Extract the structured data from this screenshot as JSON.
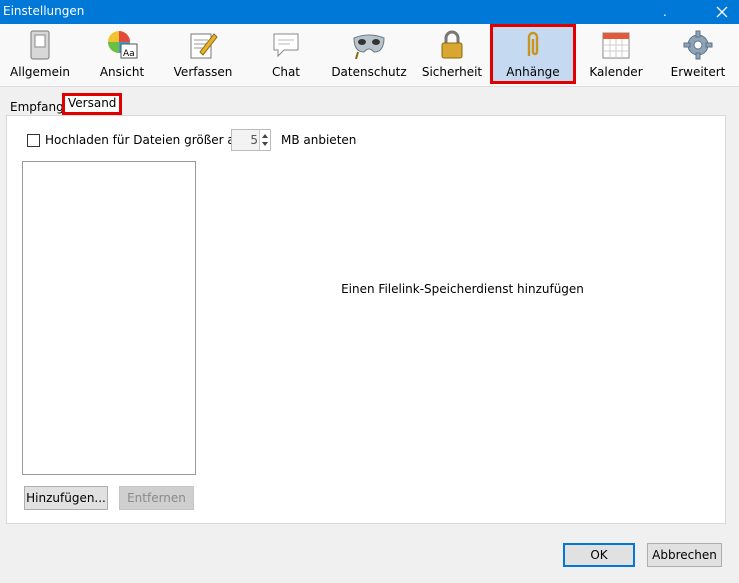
{
  "window": {
    "title": "Einstellungen",
    "dot": "."
  },
  "toolbar": [
    {
      "label": "Allgemein",
      "icon": "switch-icon"
    },
    {
      "label": "Ansicht",
      "icon": "palette-icon"
    },
    {
      "label": "Verfassen",
      "icon": "compose-icon"
    },
    {
      "label": "Chat",
      "icon": "chat-bubble-icon"
    },
    {
      "label": "Datenschutz",
      "icon": "mask-icon"
    },
    {
      "label": "Sicherheit",
      "icon": "padlock-icon"
    },
    {
      "label": "Anhänge",
      "icon": "paperclip-icon",
      "selected": true
    },
    {
      "label": "Kalender",
      "icon": "calendar-icon"
    },
    {
      "label": "Erweitert",
      "icon": "gear-icon"
    }
  ],
  "subtabs": [
    {
      "label": "Empfang"
    },
    {
      "label": "Versand",
      "active": true
    }
  ],
  "upload": {
    "checkbox_label": "Hochladen für Dateien größer als",
    "checked": false,
    "size_value": "5",
    "unit_label": "MB anbieten"
  },
  "providers": {
    "hint": "Einen Filelink-Speicherdienst hinzufügen",
    "add_label": "Hinzufügen...",
    "remove_label": "Entfernen"
  },
  "footer": {
    "ok_label": "OK",
    "cancel_label": "Abbrechen"
  },
  "colors": {
    "titlebar": "#0078d7",
    "highlight_border": "#e00000",
    "selected_bg": "#c5d9f1"
  }
}
